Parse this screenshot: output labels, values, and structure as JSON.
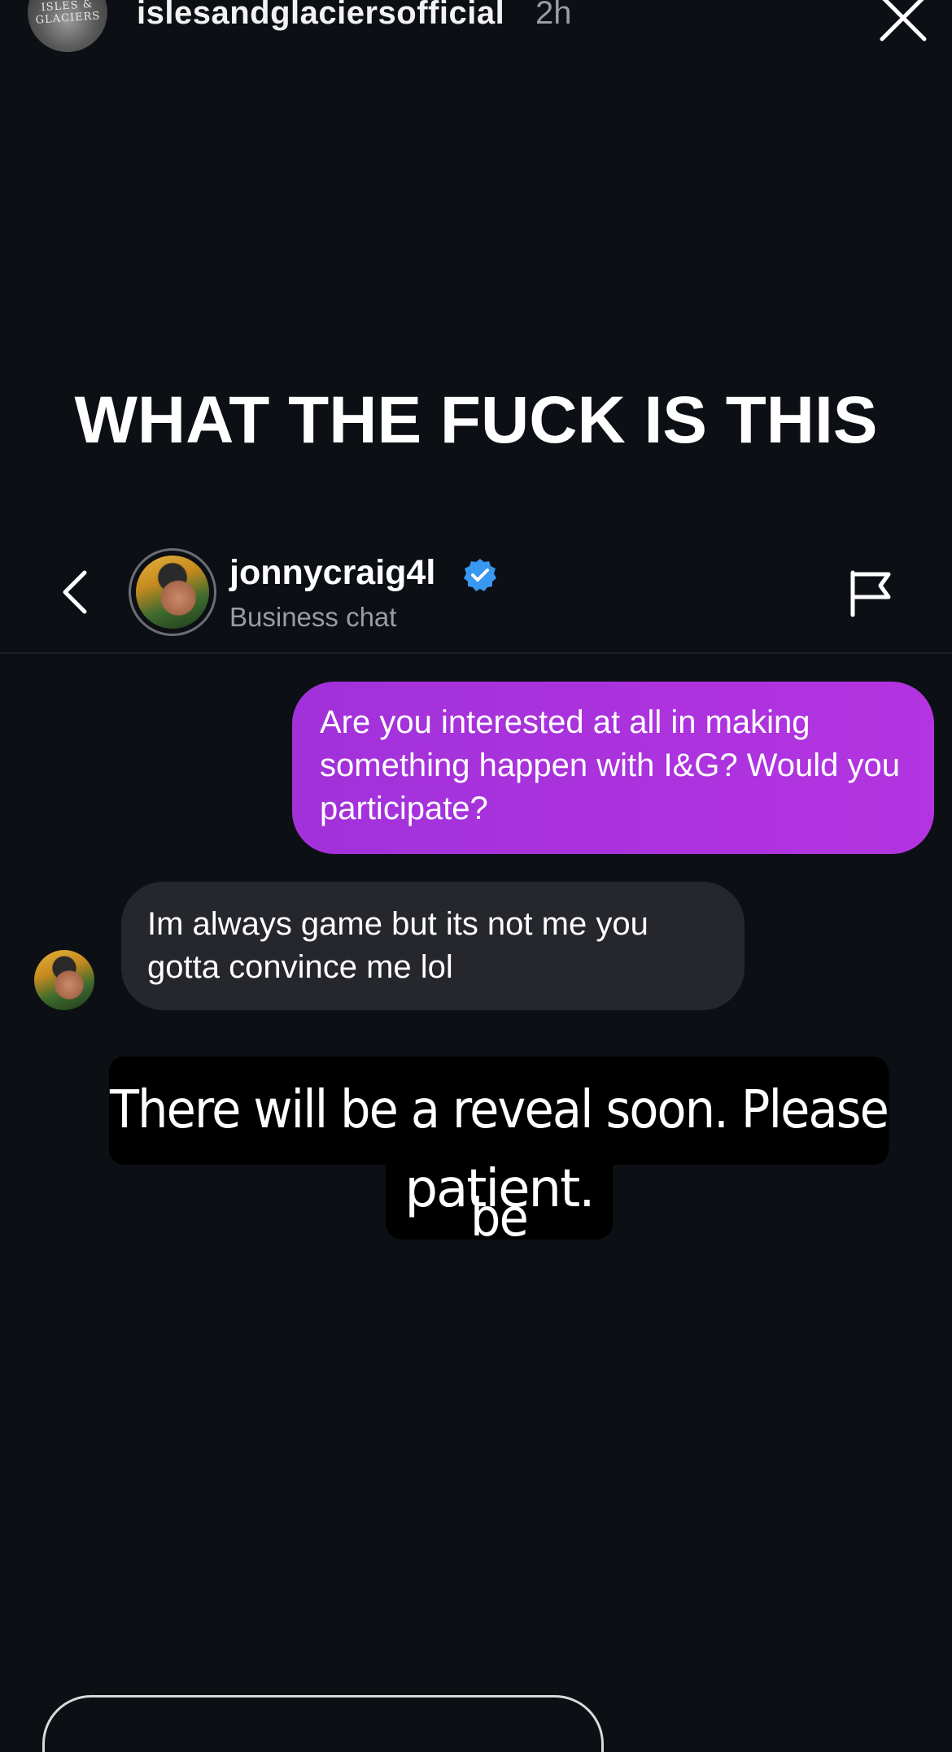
{
  "story": {
    "username": "islesandglaciersofficial",
    "time": "2h",
    "avatar_text": "ISLES & GLACIERS"
  },
  "headline": "WHAT THE FUCK IS THIS",
  "dm": {
    "name": "jonnycraig4l",
    "subtitle": "Business chat",
    "messages": [
      {
        "from": "me",
        "text": "Are you interested at all in making something happen with I&G? Would you participate?"
      },
      {
        "from": "them",
        "text": "Im always game but its not me you gotta convince me lol"
      }
    ]
  },
  "caption": {
    "line1": "There will be a reveal soon. Please be",
    "line2": "patient."
  },
  "icons": {
    "close": "close-icon",
    "back": "chevron-left-icon",
    "verified": "verified-badge-icon",
    "flag": "flag-icon"
  },
  "colors": {
    "background": "#0c0f14",
    "outgoing_bubble": "#a231da",
    "incoming_bubble": "#25272d",
    "verified": "#3897f0"
  }
}
